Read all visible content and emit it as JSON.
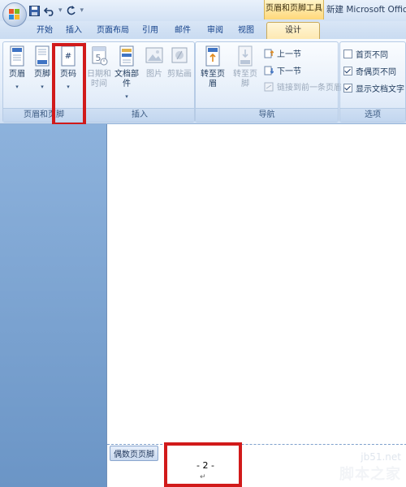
{
  "title_bar": {
    "context_tools": "页眉和页脚工具",
    "document_title": "新建 Microsoft Office W"
  },
  "tabs": [
    {
      "label": "开始"
    },
    {
      "label": "插入"
    },
    {
      "label": "页面布局"
    },
    {
      "label": "引用"
    },
    {
      "label": "邮件"
    },
    {
      "label": "审阅"
    },
    {
      "label": "视图"
    },
    {
      "label": "设计",
      "active": true
    }
  ],
  "ribbon": {
    "groups": {
      "header_footer": {
        "label": "页眉和页脚",
        "buttons": {
          "header": "页眉",
          "footer": "页脚",
          "page_number": "页码"
        }
      },
      "insert": {
        "label": "插入",
        "buttons": {
          "date_time_1": "日期和",
          "date_time_2": "时间",
          "quick_parts": "文档部件",
          "picture": "图片",
          "clip_art": "剪贴画"
        }
      },
      "navigation": {
        "label": "导航",
        "buttons": {
          "goto_header": "转至页眉",
          "goto_footer": "转至页脚",
          "prev_section": "上一节",
          "next_section": "下一节",
          "link_prev": "链接到前一条页眉"
        }
      },
      "options": {
        "label": "选项",
        "checkboxes": [
          {
            "label": "首页不同",
            "checked": false
          },
          {
            "label": "奇偶页不同",
            "checked": true
          },
          {
            "label": "显示文档文字",
            "checked": true
          }
        ]
      }
    }
  },
  "document": {
    "footer_tag": "偶数页页脚",
    "page_number": "- 2 -",
    "paragraph_mark": "↵"
  },
  "watermark": {
    "url": "jb51.net",
    "text": "脚本之家"
  },
  "colors": {
    "highlight": "#d11a1a",
    "context_tab": "#ffd87a",
    "workspace": "#7ba3d3"
  }
}
